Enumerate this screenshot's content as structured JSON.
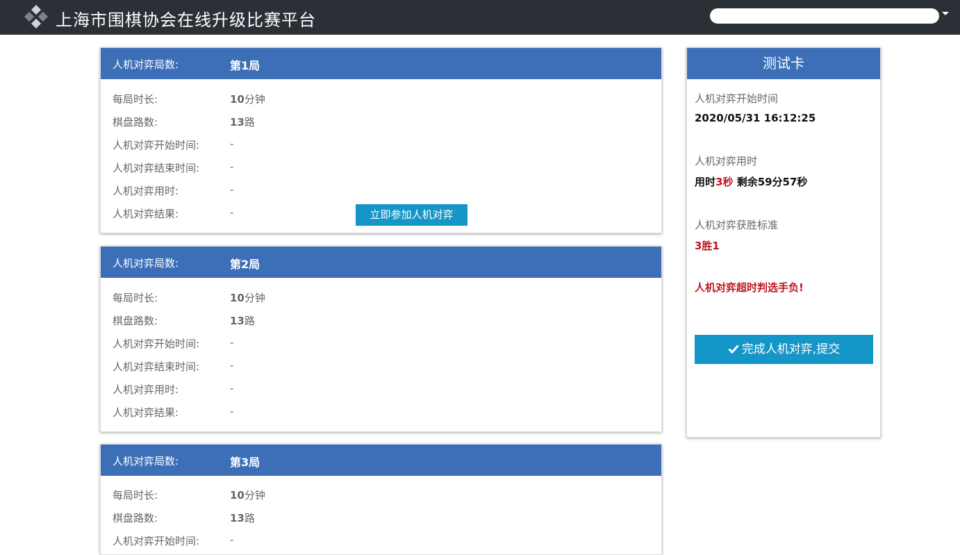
{
  "header": {
    "site_title": "上海市围棋协会在线升级比赛平台",
    "logo_icon": "go-stones-logo-icon",
    "user_menu_icon": "caret-down-icon"
  },
  "rounds": [
    {
      "header_label": "人机对弈局数:",
      "header_value": "第1局",
      "rows": [
        {
          "label": "每局时长:",
          "value_num": "10",
          "value_unit": "分钟"
        },
        {
          "label": "棋盘路数:",
          "value_num": "13",
          "value_unit": "路"
        },
        {
          "label": "人机对弈开始时间:",
          "value": "-"
        },
        {
          "label": "人机对弈结束时间:",
          "value": "-"
        },
        {
          "label": "人机对弈用时:",
          "value": "-"
        },
        {
          "label": "人机对弈结果:",
          "value": "-"
        }
      ],
      "join_button": "立即参加人机对弈"
    },
    {
      "header_label": "人机对弈局数:",
      "header_value": "第2局",
      "rows": [
        {
          "label": "每局时长:",
          "value_num": "10",
          "value_unit": "分钟"
        },
        {
          "label": "棋盘路数:",
          "value_num": "13",
          "value_unit": "路"
        },
        {
          "label": "人机对弈开始时间:",
          "value": "-"
        },
        {
          "label": "人机对弈结束时间:",
          "value": "-"
        },
        {
          "label": "人机对弈用时:",
          "value": "-"
        },
        {
          "label": "人机对弈结果:",
          "value": "-"
        }
      ]
    },
    {
      "header_label": "人机对弈局数:",
      "header_value": "第3局",
      "rows": [
        {
          "label": "每局时长:",
          "value_num": "10",
          "value_unit": "分钟"
        },
        {
          "label": "棋盘路数:",
          "value_num": "13",
          "value_unit": "路"
        },
        {
          "label": "人机对弈开始时间:",
          "value": "-"
        }
      ]
    }
  ],
  "test_card": {
    "title": "测试卡",
    "start_time_label": "人机对弈开始时间",
    "start_time_value": "2020/05/31 16:12:25",
    "used_time_label": "人机对弈用时",
    "used_prefix": "用时",
    "used_seconds": "3秒",
    "remaining": "剩余59分57秒",
    "win_standard_label": "人机对弈获胜标准",
    "win_standard_value": "3胜1",
    "timeout_warning": "人机对弈超时判选手负!",
    "submit_button": "完成人机对弈,提交",
    "submit_icon": "check-icon"
  },
  "colors": {
    "topbar": "#2b2f36",
    "card_header": "#3d6fb8",
    "button": "#1596c8",
    "warning_red": "#c0141f"
  }
}
